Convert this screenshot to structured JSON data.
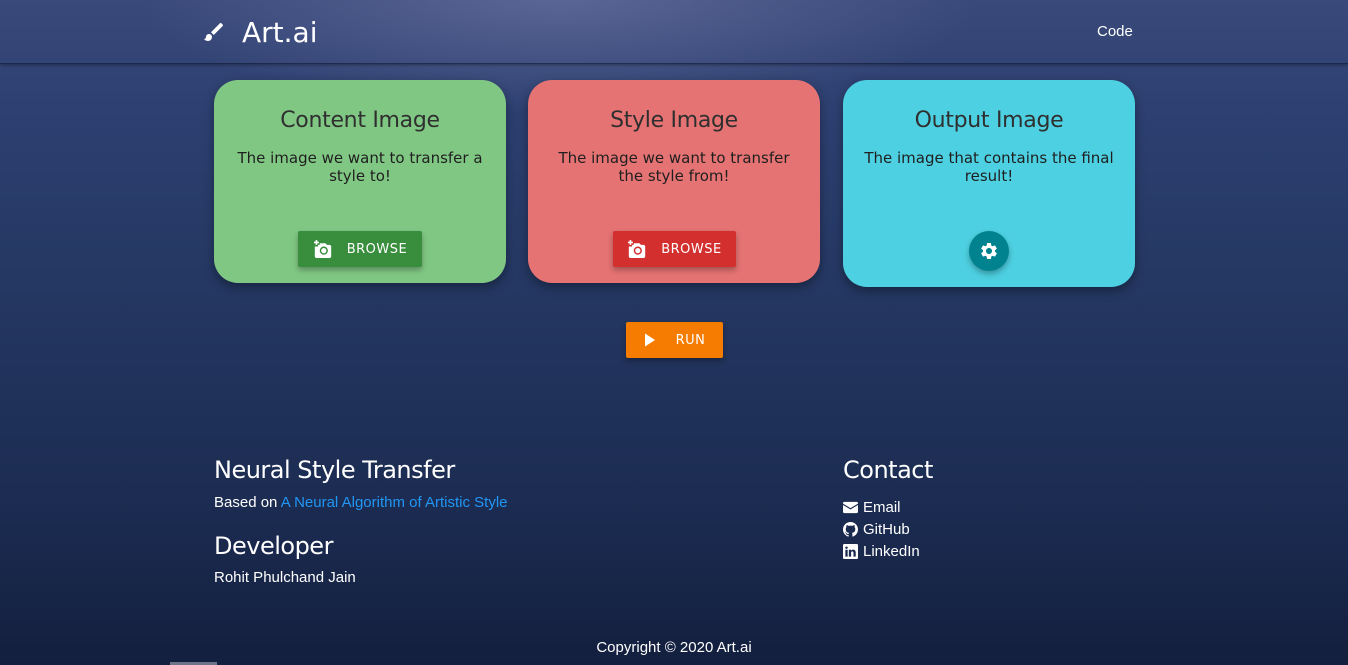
{
  "navbar": {
    "brand": "Art.ai",
    "brand_icon": "paintbrush-icon",
    "code_link": "Code"
  },
  "cards": {
    "content": {
      "title": "Content Image",
      "description": "The image we want to transfer a style to!",
      "button_label": "BROWSE",
      "button_icon": "add-photo-icon",
      "color": "#81c784",
      "button_color": "#388e3c"
    },
    "style": {
      "title": "Style Image",
      "description": "The image we want to transfer the style from!",
      "button_label": "BROWSE",
      "button_icon": "add-photo-icon",
      "color": "#e57373",
      "button_color": "#d32f2f"
    },
    "output": {
      "title": "Output Image",
      "description": "The image that contains the final result!",
      "button_icon": "gear-icon",
      "color": "#4dd0e1",
      "button_color": "#00838f"
    }
  },
  "run": {
    "label": "RUN",
    "icon": "play-icon",
    "color": "#f57c00"
  },
  "footer": {
    "about": {
      "title": "Neural Style Transfer",
      "based_on_prefix": "Based on",
      "link_text": "A Neural Algorithm of Artistic Style"
    },
    "developer": {
      "title": "Developer",
      "name": "Rohit Phulchand Jain"
    },
    "contact": {
      "title": "Contact",
      "items": [
        {
          "label": "Email",
          "icon": "envelope-icon"
        },
        {
          "label": "GitHub",
          "icon": "github-icon"
        },
        {
          "label": "LinkedIn",
          "icon": "linkedin-icon"
        }
      ]
    },
    "copyright": "Copyright © 2020 Art.ai"
  }
}
